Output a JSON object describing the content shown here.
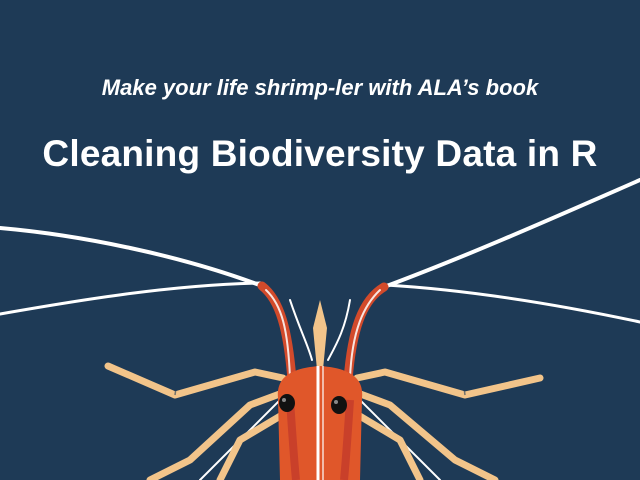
{
  "banner": {
    "subtitle": "Make your life shrimp-ler with ALA’s book",
    "title": "Cleaning Biodiversity Data in R"
  },
  "colors": {
    "background": "#1e3a56",
    "text": "#ffffff",
    "shrimp_orange": "#e0572a",
    "shrimp_red": "#c9402a",
    "leg_tan": "#f2c48a",
    "eye": "#111111",
    "antenna": "#ffffff"
  }
}
